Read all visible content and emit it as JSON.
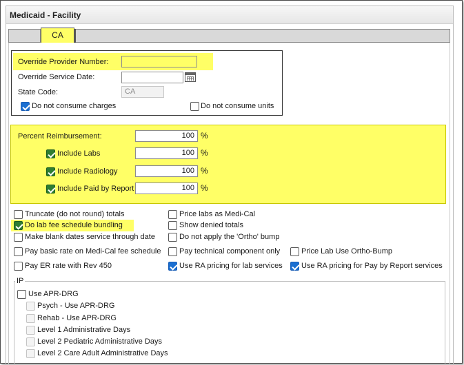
{
  "window": {
    "title": "Medicaid - Facility"
  },
  "tabs": {
    "active": "CA"
  },
  "override": {
    "provider_number_label": "Override Provider Number:",
    "provider_number_value": "",
    "service_date_label": "Override Service Date:",
    "service_date_value": "",
    "state_code_label": "State Code:",
    "state_code_value": "CA",
    "consume_charges_label": "Do not consume charges",
    "consume_units_label": "Do not consume units"
  },
  "reimbursement": {
    "percent_label": "Percent Reimbursement:",
    "percent_value": "100",
    "unit": "%",
    "labs_label": "Include Labs",
    "labs_value": "100",
    "radiology_label": "Include Radiology",
    "radiology_value": "100",
    "paid_by_report_label": "Include Paid by Report",
    "paid_by_report_value": "100"
  },
  "options": {
    "truncate": "Truncate (do not round) totals",
    "lab_bundling": "Do lab fee schedule bundling",
    "blank_dates": "Make blank dates service through date",
    "basic_rate": "Pay basic rate on Medi-Cal fee schedule",
    "er_rate": "Pay ER rate with Rev 450",
    "price_labs": "Price labs as Medi-Cal",
    "show_denied": "Show denied totals",
    "ortho_bump": "Do not apply the 'Ortho' bump",
    "technical": "Pay technical component only",
    "ra_lab": "Use RA pricing for lab services",
    "price_lab_ortho": "Price Lab Use Ortho-Bump",
    "ra_report": "Use RA pricing for Pay by Report services"
  },
  "ip": {
    "legend": "IP",
    "apr_drg": "Use APR-DRG",
    "psych": "Psych - Use APR-DRG",
    "rehab": "Rehab - Use APR-DRG",
    "level1": "Level 1 Administrative Days",
    "level2_ped": "Level 2 Pediatric Administrative Days",
    "level2_adult": "Level 2 Care Adult Administrative Days"
  },
  "colors": {
    "highlight": "#ffff66",
    "checkbox_blue": "#1a6fd1",
    "checkbox_green": "#2e7d32"
  },
  "icons": {
    "calendar": "calendar-icon"
  }
}
